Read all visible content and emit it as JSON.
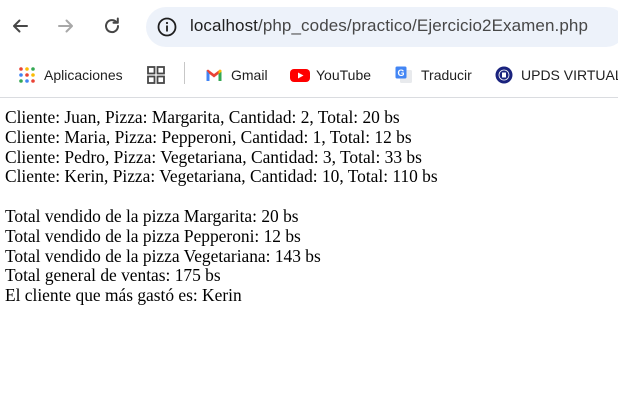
{
  "browser": {
    "url_host": "localhost",
    "url_path": "/php_codes/practico/Ejercicio2Examen.php",
    "nav": {
      "back_icon": "arrow-left-icon",
      "forward_icon": "arrow-right-icon",
      "reload_icon": "reload-icon",
      "site_info_icon": "site-info-icon"
    },
    "bookmarks": [
      {
        "label": "Aplicaciones",
        "icon": "apps-grid-icon"
      },
      {
        "label": "",
        "icon": "tab-groups-icon"
      },
      {
        "label": "Gmail",
        "icon": "gmail-icon"
      },
      {
        "label": "YouTube",
        "icon": "youtube-icon"
      },
      {
        "label": "Traducir",
        "icon": "translate-icon"
      },
      {
        "label": "UPDS VIRTUAL",
        "icon": "upds-icon"
      }
    ]
  },
  "page": {
    "orders": [
      "Cliente: Juan, Pizza: Margarita, Cantidad: 2, Total: 20 bs",
      "Cliente: Maria, Pizza: Pepperoni, Cantidad: 1, Total: 12 bs",
      "Cliente: Pedro, Pizza: Vegetariana, Cantidad: 3, Total: 33 bs",
      "Cliente: Kerin, Pizza: Vegetariana, Cantidad: 10, Total: 110 bs"
    ],
    "summary": [
      "Total vendido de la pizza Margarita: 20 bs",
      "Total vendido de la pizza Pepperoni: 12 bs",
      "Total vendido de la pizza Vegetariana: 143 bs",
      "Total general de ventas: 175 bs",
      "El cliente que más gastó es: Kerin"
    ]
  }
}
